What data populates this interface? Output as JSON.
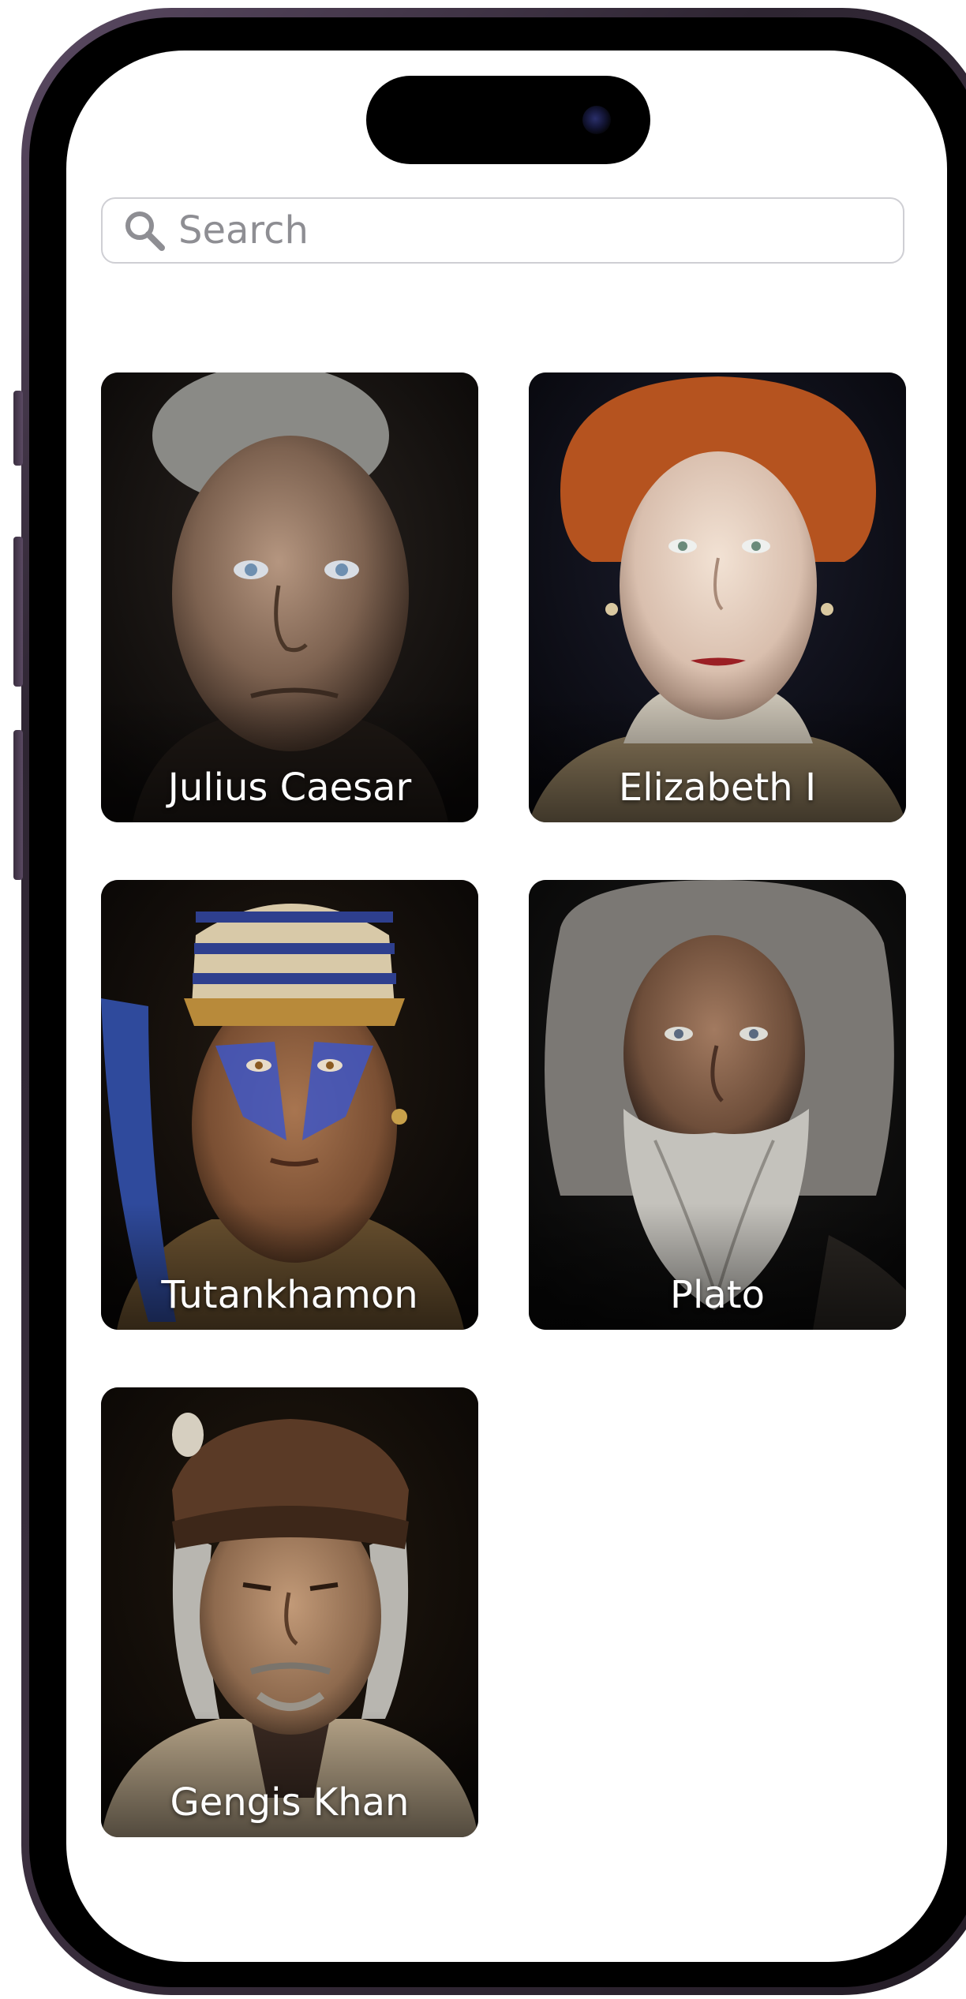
{
  "search": {
    "placeholder": "Search",
    "icon": "search-icon"
  },
  "figures": [
    {
      "name": "Julius Caesar",
      "portrait": "aged-roman-man-portrait"
    },
    {
      "name": "Elizabeth I",
      "portrait": "red-haired-queen-portrait"
    },
    {
      "name": "Tutankhamon",
      "portrait": "egyptian-pharaoh-portrait"
    },
    {
      "name": "Plato",
      "portrait": "bearded-philosopher-portrait"
    },
    {
      "name": "Gengis Khan",
      "portrait": "mongol-warrior-portrait"
    }
  ],
  "colors": {
    "frame": "#3c3040",
    "screen_background": "#ffffff",
    "card_background": "#0d0b0a",
    "card_label": "#ffffff",
    "search_border": "#cfcfd4",
    "search_placeholder": "#8e8e93"
  }
}
